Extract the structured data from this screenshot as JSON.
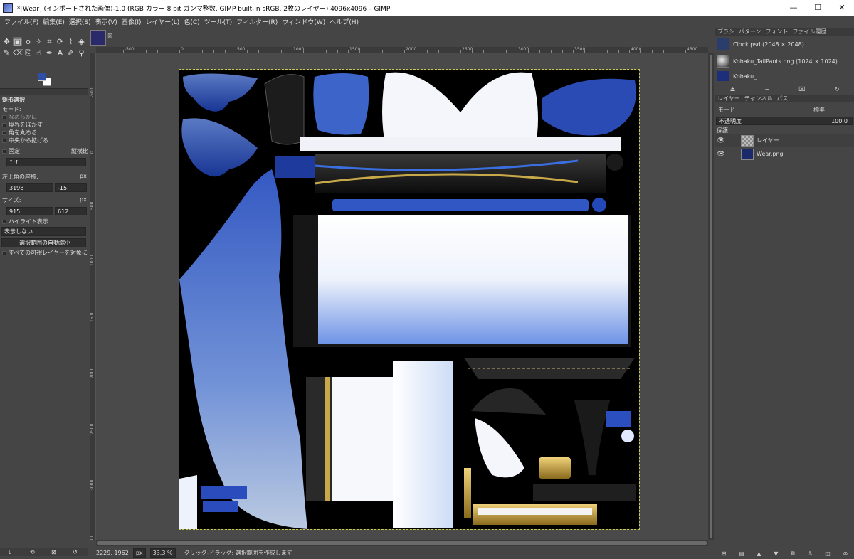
{
  "window": {
    "title": "*[Wear] (インポートされた画像)-1.0 (RGB カラー 8 bit ガンマ整数, GIMP built-in sRGB, 2枚のレイヤー) 4096x4096 – GIMP",
    "min": "—",
    "max": "☐",
    "close": "✕"
  },
  "menu": [
    "ファイル(F)",
    "編集(E)",
    "選択(S)",
    "表示(V)",
    "画像(I)",
    "レイヤー(L)",
    "色(C)",
    "ツール(T)",
    "フィルター(R)",
    "ウィンドウ(W)",
    "ヘルプ(H)"
  ],
  "toolbox": {
    "tools": [
      {
        "name": "move-tool-icon",
        "glyph": "✥"
      },
      {
        "name": "rect-select-tool-icon",
        "glyph": "▣"
      },
      {
        "name": "lasso-tool-icon",
        "glyph": "ϙ"
      },
      {
        "name": "fuzzy-select-tool-icon",
        "glyph": "✧"
      },
      {
        "name": "crop-tool-icon",
        "glyph": "⌗"
      },
      {
        "name": "rotate-tool-icon",
        "glyph": "⟳"
      },
      {
        "name": "warp-tool-icon",
        "glyph": "⌇"
      },
      {
        "name": "fill-tool-icon",
        "glyph": "◈"
      },
      {
        "name": "paint-tool-icon",
        "glyph": "✎"
      },
      {
        "name": "eraser-tool-icon",
        "glyph": "⌫"
      },
      {
        "name": "clone-tool-icon",
        "glyph": "⎘"
      },
      {
        "name": "smudge-tool-icon",
        "glyph": "☝"
      },
      {
        "name": "path-tool-icon",
        "glyph": "✒"
      },
      {
        "name": "text-tool-icon",
        "glyph": "A"
      },
      {
        "name": "color-picker-tool-icon",
        "glyph": "✐"
      },
      {
        "name": "zoom-tool-icon",
        "glyph": "⚲"
      }
    ],
    "fg_color": "#2e4fa5",
    "bg_color": "#ffffff"
  },
  "tool_options": {
    "title": "矩形選択",
    "mode_label": "モード:",
    "antialias": "なめらかに",
    "feather": "境界をぼかす",
    "rounded": "角を丸める",
    "expand": "中央から拡げる",
    "fixed_label": "固定",
    "fixed_mode": "縦横比",
    "ratio": "1:1",
    "position_label": "左上角の座標:",
    "position_unit": "px",
    "pos_x": "3198",
    "pos_y": "-15",
    "size_label": "サイズ:",
    "size_unit": "px",
    "size_w": "915",
    "size_h": "612",
    "highlight": "ハイライト表示",
    "guides": "表示しない",
    "autoshrink": "選択範囲の自動縮小",
    "all_layers": "すべての可視レイヤーを対象に"
  },
  "ruler": {
    "labels": [
      "-500",
      "0",
      "500",
      "1000",
      "1500",
      "2000",
      "2500",
      "3000",
      "3500",
      "4000",
      "4500"
    ]
  },
  "status": {
    "coords": "2229, 1962",
    "unit": "px",
    "zoom": "33.3 %",
    "message": "クリック-ドラッグ: 選択範囲を作成します"
  },
  "right_dock": {
    "tabs_top": [
      "ブラシ",
      "パターン",
      "フォント",
      "ファイル履歴"
    ],
    "history": [
      {
        "name": "Clock.psd (2048 × 2048)"
      },
      {
        "name": "Kohaku_TailPants.png (1024 × 1024)"
      },
      {
        "name": "Kohaku_..."
      }
    ],
    "tabs_layers": [
      "レイヤー",
      "チャンネル",
      "パス"
    ],
    "mode_label": "モード",
    "mode_value": "標準",
    "opacity_label": "不透明度",
    "opacity_value": "100.0",
    "lock_label": "保護:",
    "layers": [
      {
        "name": "レイヤー",
        "visible": true
      },
      {
        "name": "Wear.png",
        "visible": true
      }
    ]
  }
}
